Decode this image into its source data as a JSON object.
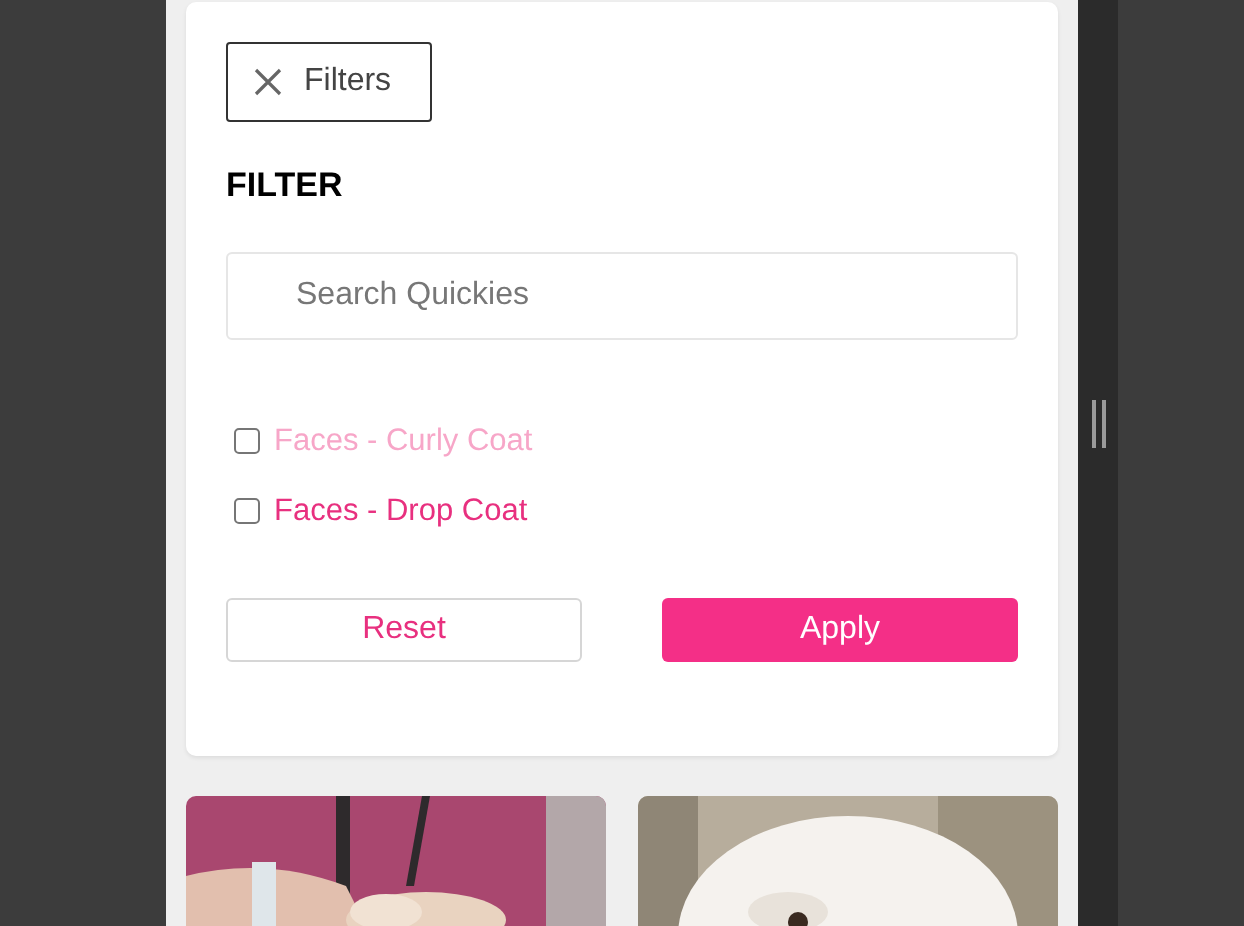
{
  "filters_button": {
    "label": "Filters"
  },
  "heading": "FILTER",
  "search": {
    "placeholder": "Search Quickies"
  },
  "options": [
    {
      "label": "Faces - Curly Coat",
      "checked": false,
      "color": "#f7a6c8"
    },
    {
      "label": "Faces - Drop Coat",
      "checked": false,
      "color": "#e8307f"
    }
  ],
  "buttons": [
    {
      "label": "Reset",
      "kind": "outline"
    },
    {
      "label": "Apply",
      "kind": "primary"
    }
  ]
}
